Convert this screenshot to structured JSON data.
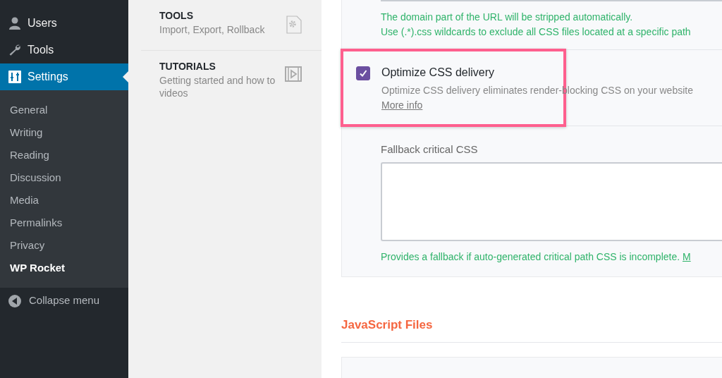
{
  "sidebar": {
    "menu": [
      {
        "label": "Users",
        "kind": "user",
        "selected": false
      },
      {
        "label": "Tools",
        "kind": "wrench",
        "selected": false
      },
      {
        "label": "Settings",
        "kind": "sliders",
        "selected": true
      }
    ],
    "submenu": [
      {
        "label": "General",
        "selected": false
      },
      {
        "label": "Writing",
        "selected": false
      },
      {
        "label": "Reading",
        "selected": false
      },
      {
        "label": "Discussion",
        "selected": false
      },
      {
        "label": "Media",
        "selected": false
      },
      {
        "label": "Permalinks",
        "selected": false
      },
      {
        "label": "Privacy",
        "selected": false
      },
      {
        "label": "WP Rocket",
        "selected": true
      }
    ],
    "collapse": {
      "label": "Collapse menu"
    }
  },
  "panel": {
    "items": [
      {
        "title": "TOOLS",
        "description": "Import, Export, Rollback",
        "kind": "gear"
      },
      {
        "title": "TUTORIALS",
        "description": "Getting started and how to videos",
        "kind": "video"
      }
    ]
  },
  "content": {
    "help_lines": [
      "The domain part of the URL will be stripped automatically.",
      "Use (.*).css wildcards to exclude all CSS files located at a specific path"
    ],
    "option": {
      "label": "Optimize CSS delivery",
      "checked": true,
      "highlighted": true,
      "description": "Optimize CSS delivery eliminates render-blocking CSS on your website",
      "link": "More info"
    },
    "fallback": {
      "label": "Fallback critical CSS",
      "help": "Provides a fallback if auto-generated critical path CSS is incomplete.",
      "help_link": "M"
    },
    "section_heading": "JavaScript Files"
  }
}
